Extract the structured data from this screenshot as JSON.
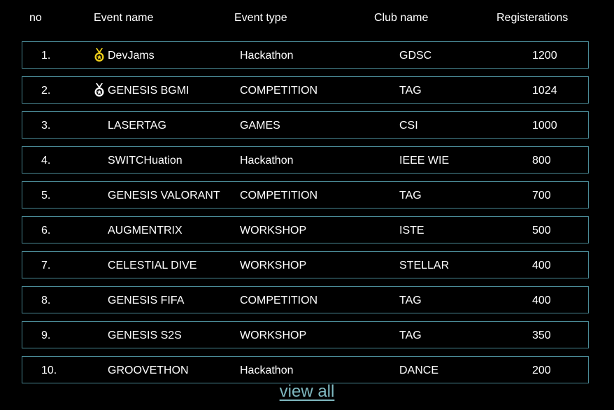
{
  "header": {
    "no": "no",
    "event_name": "Event name",
    "event_type": "Event type",
    "club_name": "Club name",
    "registrations": "Registerations"
  },
  "rows": [
    {
      "no": "1.",
      "name": "DevJams",
      "type": "Hackathon",
      "club": "GDSC",
      "registrations": "1200",
      "medal": "gold-medal-icon"
    },
    {
      "no": "2.",
      "name": "GENESIS BGMI",
      "type": "COMPETITION",
      "club": "TAG",
      "registrations": "1024",
      "medal": "silver-medal-icon"
    },
    {
      "no": "3.",
      "name": "LASERTAG",
      "type": "GAMES",
      "club": "CSI",
      "registrations": "1000"
    },
    {
      "no": "4.",
      "name": "SWITCHuation",
      "type": "Hackathon",
      "club": "IEEE WIE",
      "registrations": "800"
    },
    {
      "no": "5.",
      "name": "GENESIS VALORANT",
      "type": "COMPETITION",
      "club": "TAG",
      "registrations": "700"
    },
    {
      "no": "6.",
      "name": "AUGMENTRIX",
      "type": "WORKSHOP",
      "club": "ISTE",
      "registrations": "500"
    },
    {
      "no": "7.",
      "name": "CELESTIAL DIVE",
      "type": "WORKSHOP",
      "club": "STELLAR",
      "registrations": "400"
    },
    {
      "no": "8.",
      "name": "GENESIS FIFA",
      "type": "COMPETITION",
      "club": "TAG",
      "registrations": "400"
    },
    {
      "no": "9.",
      "name": "GENESIS S2S",
      "type": "WORKSHOP",
      "club": "TAG",
      "registrations": "350"
    },
    {
      "no": "10.",
      "name": "GROOVETHON",
      "type": "Hackathon",
      "club": "DANCE",
      "registrations": "200"
    }
  ],
  "view_all_label": "view all",
  "colors": {
    "background": "#000000",
    "row_border": "#4a8a96",
    "link": "#7fb8c0",
    "gold": "#f2d21b",
    "silver": "#ffffff"
  }
}
